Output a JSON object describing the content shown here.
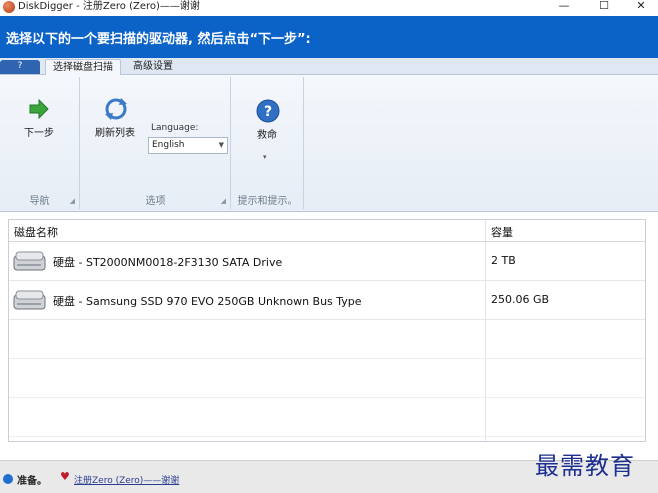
{
  "window": {
    "title": "DiskDigger - 注册Zero (Zero)——谢谢",
    "min_glyph": "—",
    "max_glyph": "☐",
    "close_glyph": "✕"
  },
  "header": {
    "instruction": "选择以下的一个要扫描的驱动器, 然后点击“下一步”:"
  },
  "ribbon": {
    "help_tab": "?",
    "tabs": [
      {
        "label": "选择磁盘扫描",
        "active": true
      },
      {
        "label": "高级设置",
        "active": false
      }
    ],
    "groups": {
      "navigation": {
        "label": "导航",
        "next_label": "下一步"
      },
      "options": {
        "label": "选项",
        "refresh_label": "刷新列表",
        "language_label": "Language:",
        "language_value": "English"
      },
      "tips": {
        "label": "提示和提示。",
        "help_label": "救命",
        "more_glyph": "▾"
      }
    }
  },
  "disk_list": {
    "columns": [
      "磁盘名称",
      "容量"
    ],
    "rows": [
      {
        "name": "硬盘 - ST2000NM0018-2F3130 SATA Drive",
        "size": "2 TB"
      },
      {
        "name": "硬盘 - Samsung SSD 970 EVO 250GB Unknown Bus Type",
        "size": "250.06 GB"
      }
    ]
  },
  "status": {
    "text": "准备。",
    "register_link": "注册Zero (Zero)——谢谢"
  },
  "watermark": "最需教育",
  "colors": {
    "header_bg": "#0b63c8",
    "help_tab": "#2f64b0",
    "accent_green": "#3aa53a"
  }
}
